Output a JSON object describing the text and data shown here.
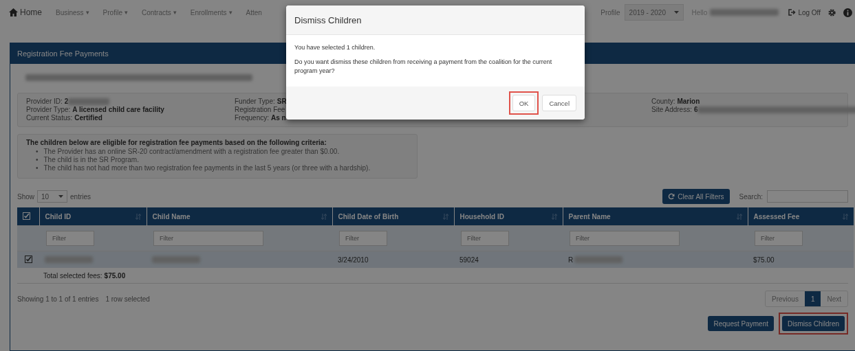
{
  "navbar": {
    "home": "Home",
    "menus": [
      {
        "label": "Business",
        "caret": "▾"
      },
      {
        "label": "Profile",
        "caret": "▾"
      },
      {
        "label": "Contracts",
        "caret": "▾"
      },
      {
        "label": "Enrollments",
        "caret": "▾"
      },
      {
        "label": "Atten"
      }
    ],
    "profile_label": "Profile",
    "year": "2019 - 2020",
    "greeting": "Hello",
    "logoff": "Log Off"
  },
  "panel": {
    "title": "Registration Fee Payments",
    "info_columns": [
      [
        {
          "label": "Provider ID:",
          "value": "2",
          "redacted": true
        },
        {
          "label": "Provider Type:",
          "value": "A licensed child care facility",
          "redacted": false
        },
        {
          "label": "Current Status:",
          "value": "Certified",
          "redacted": false
        }
      ],
      [
        {
          "label": "Funder Type:",
          "value": "SR",
          "redacted": false
        },
        {
          "label": "Registration Fee",
          "redacted": false
        },
        {
          "label": "Frequency:",
          "value": "As n",
          "redacted": false
        }
      ],
      [
        {
          "label": "County:",
          "value": "Marion",
          "redacted": false
        },
        {
          "label": "Site Address:",
          "value": "6",
          "redacted": true
        }
      ]
    ],
    "criteria": {
      "heading": "The children below are eligible for registration fee payments based on the following criteria:",
      "items": [
        {
          "bullet": "•",
          "text": "The Provider has an online SR-20 contract/amendment with a registration fee greater than $0.00."
        },
        {
          "bullet": "•",
          "text": "The child is in the SR Program."
        },
        {
          "bullet": "•",
          "text": "The child has not had more than two registration fee payments in the last 5 years (or three with a hardship)."
        }
      ]
    },
    "length": {
      "show": "Show",
      "value": "10",
      "entries": "entries"
    },
    "clear_filters": "Clear All Filters",
    "search_label": "Search:",
    "table": {
      "select_all_checked": true,
      "columns": [
        "Child ID",
        "Child Name",
        "Child Date of Birth",
        "Household ID",
        "Parent Name",
        "Assessed Fee"
      ],
      "filters": [
        {
          "placeholder": "Filter"
        },
        {
          "placeholder": "Filter"
        },
        {
          "placeholder": "Filter"
        },
        {
          "placeholder": "Filter"
        },
        {
          "placeholder": "Filter"
        },
        {
          "placeholder": "Filter"
        }
      ],
      "rows": [
        {
          "selected": true,
          "cells": [
            {
              "redacted": true
            },
            {
              "redacted": true
            },
            {
              "text": "3/24/2010",
              "redacted": false
            },
            {
              "text": "59024",
              "redacted": false
            },
            {
              "text": "R",
              "redacted": true
            },
            {
              "text": "$75.00",
              "redacted": false
            }
          ]
        }
      ],
      "total_label": "Total selected fees:",
      "total_value": "$75.00"
    },
    "info": "Showing 1 to 1 of 1 entries",
    "selection_info": "1 row selected",
    "pagination": [
      {
        "label": "Previous",
        "selected": false
      },
      {
        "label": "1",
        "selected": true
      },
      {
        "label": "Next",
        "selected": false
      }
    ],
    "actions": [
      {
        "label": "Request Payment",
        "highlighted": false
      },
      {
        "label": "Dismiss Children",
        "highlighted": true
      }
    ]
  },
  "modal": {
    "title": "Dismiss Children",
    "messages": [
      "You have selected 1 children.",
      "Do you want dismiss these children from receiving a payment from the coalition for the current program year?"
    ],
    "buttons": [
      {
        "label": "OK",
        "highlighted": true
      },
      {
        "label": "Cancel",
        "highlighted": false
      }
    ]
  }
}
